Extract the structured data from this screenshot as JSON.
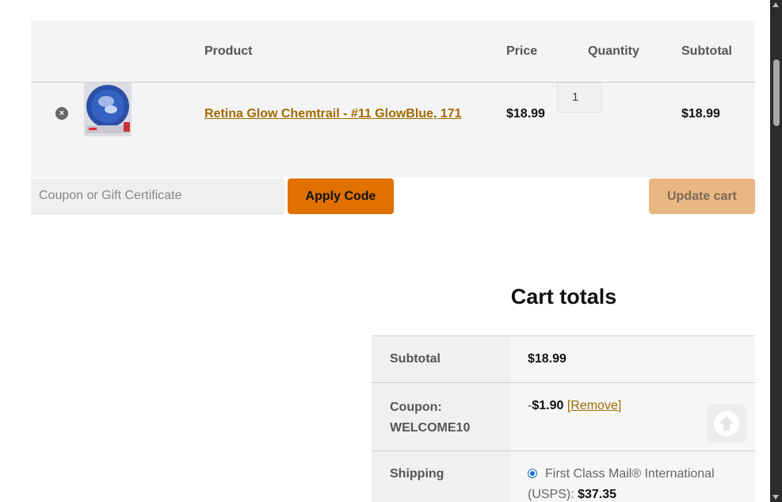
{
  "cart": {
    "headers": {
      "product": "Product",
      "price": "Price",
      "quantity": "Quantity",
      "subtotal": "Subtotal"
    },
    "items": [
      {
        "name": "Retina Glow Chemtrail - #11 GlowBlue, 171",
        "price": "$18.99",
        "quantity": "1",
        "subtotal": "$18.99",
        "thumbnail_icon": "golf-ball-product-icon"
      }
    ],
    "coupon_placeholder": "Coupon or Gift Certificate",
    "apply_label": "Apply Code",
    "update_label": "Update cart"
  },
  "totals": {
    "title": "Cart totals",
    "subtotal_label": "Subtotal",
    "subtotal_value": "$18.99",
    "coupon_label_1": "Coupon:",
    "coupon_label_2": "WELCOME10",
    "coupon_dash": "-",
    "coupon_amount": "$1.90",
    "coupon_remove": "[Remove]",
    "shipping_label": "Shipping",
    "shipping_method": "First Class Mail® International (USPS):",
    "shipping_price": "$37.35"
  },
  "colors": {
    "accent": "#e07000",
    "link": "#a26b00",
    "update_disabled": "#e9b882"
  }
}
